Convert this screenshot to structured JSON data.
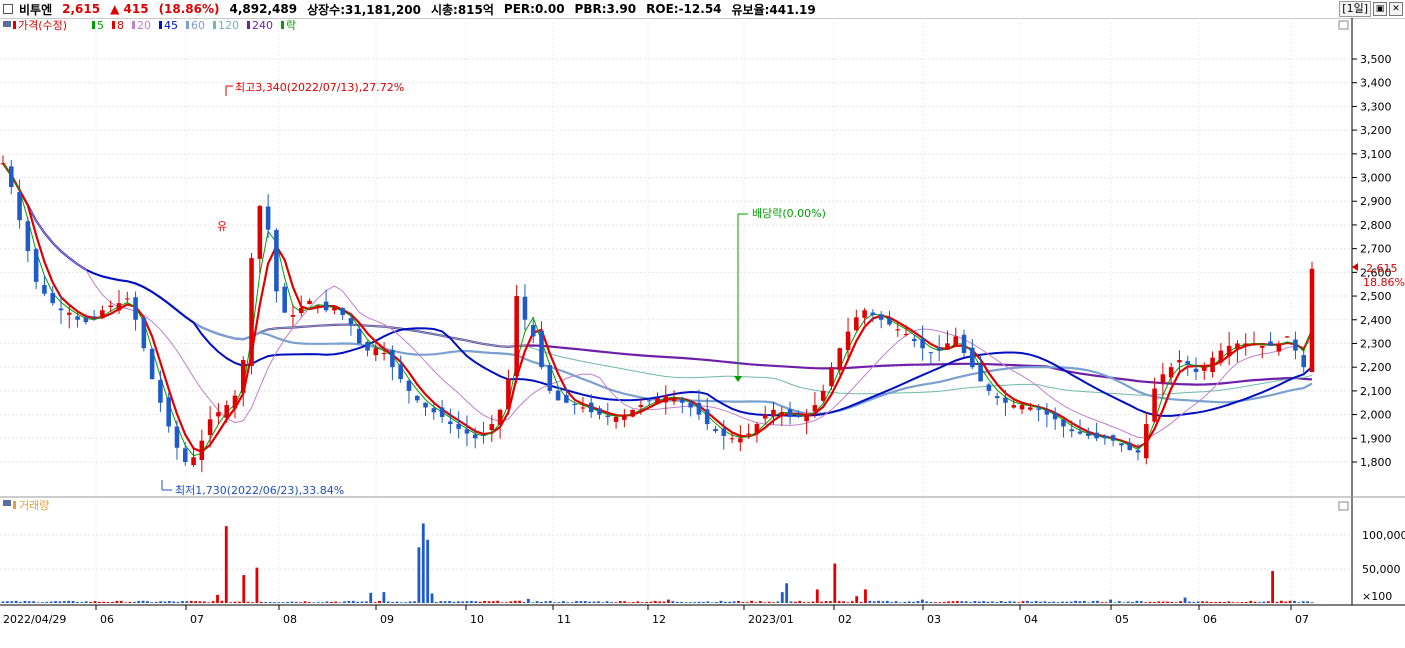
{
  "header": {
    "name": "비투엔",
    "price": "2,615",
    "change": "▲ 415",
    "change_pct": "(18.86%)",
    "volume": "4,892,489",
    "listed": "상장수:31,181,200",
    "mktcap": "시총:815억",
    "per": "PER:0.00",
    "pbr": "PBR:3.90",
    "roe": "ROE:-12.54",
    "reserve": "유보율:441.19",
    "period": "[1일]",
    "colors": {
      "up": "#e00000",
      "down": "#1e5ac8"
    }
  },
  "legend": [
    {
      "label": "가격(수정)",
      "color": "#e00000"
    },
    {
      "label": "5",
      "color": "#00a000"
    },
    {
      "label": "8",
      "color": "#e00000"
    },
    {
      "label": "20",
      "color": "#c080d0"
    },
    {
      "label": "45",
      "color": "#0010c0"
    },
    {
      "label": "60",
      "color": "#7aa0d0"
    },
    {
      "label": "120",
      "color": "#70b8a8"
    },
    {
      "label": "240",
      "color": "#7020a8"
    },
    {
      "label": "락",
      "color": "#00a000"
    }
  ],
  "annotations": {
    "high": "최고3,340(2022/07/13),27.72%",
    "low": "최저1,730(2022/06/23),33.84%",
    "dividend": "배당락(0.00%)",
    "rights_marker": "유",
    "last_price": "2,615",
    "last_pct": "18.86%"
  },
  "volume_label": "거래량",
  "chart_data": {
    "type": "candlestick",
    "y_ticks": [
      "3,500",
      "3,400",
      "3,300",
      "3,200",
      "3,100",
      "3,000",
      "2,900",
      "2,800",
      "2,700",
      "2,600",
      "2,500",
      "2,400",
      "2,300",
      "2,200",
      "2,100",
      "2,000",
      "1,900",
      "1,800"
    ],
    "volume_ticks": [
      "100,000",
      "50,000",
      "×100"
    ],
    "x_labels": [
      "2022/04/29",
      "06",
      "07",
      "08",
      "09",
      "10",
      "11",
      "12",
      "2023/01",
      "02",
      "03",
      "04",
      "05",
      "06",
      "07"
    ],
    "price_range": [
      1700,
      3600
    ],
    "volume_range": [
      0,
      125000
    ],
    "closes": [
      3060,
      2960,
      2820,
      2690,
      2560,
      2510,
      2470,
      2440,
      2430,
      2400,
      2390,
      2410,
      2440,
      2460,
      2470,
      2490,
      2400,
      2280,
      2150,
      2050,
      1950,
      1860,
      1800,
      1820,
      1890,
      1980,
      2010,
      2040,
      2080,
      2230,
      2660,
      2880,
      2780,
      2520,
      2430,
      2420,
      2450,
      2480,
      2460,
      2440,
      2450,
      2420,
      2380,
      2300,
      2270,
      2280,
      2260,
      2200,
      2150,
      2100,
      2060,
      2030,
      2010,
      1990,
      1960,
      1940,
      1920,
      1900,
      1910,
      1960,
      2020,
      2150,
      2500,
      2400,
      2330,
      2200,
      2100,
      2060,
      2050,
      2040,
      2030,
      2010,
      2000,
      1990,
      1990,
      2000,
      2020,
      2040,
      2060,
      2070,
      2080,
      2070,
      2050,
      2030,
      2000,
      1960,
      1930,
      1910,
      1900,
      1900,
      1920,
      1960,
      2000,
      2020,
      2010,
      1990,
      1990,
      2000,
      2040,
      2100,
      2200,
      2280,
      2350,
      2410,
      2440,
      2420,
      2400,
      2380,
      2360,
      2340,
      2310,
      2280,
      2260,
      2270,
      2300,
      2330,
      2260,
      2200,
      2140,
      2100,
      2070,
      2050,
      2040,
      2040,
      2030,
      2020,
      2000,
      1980,
      1950,
      1930,
      1920,
      1910,
      1900,
      1900,
      1890,
      1870,
      1850,
      1840,
      1960,
      2110,
      2170,
      2200,
      2230,
      2210,
      2180,
      2200,
      2240,
      2270,
      2290,
      2300,
      2300,
      2300,
      2290,
      2290,
      2300,
      2330,
      2270,
      2200,
      2615
    ],
    "volume_peaks": [
      [
        49,
        12000
      ],
      [
        51,
        113000
      ],
      [
        55,
        41000
      ],
      [
        58,
        52000
      ],
      [
        84,
        15000
      ],
      [
        87,
        16000
      ],
      [
        95,
        82000
      ],
      [
        96,
        117000
      ],
      [
        97,
        93000
      ],
      [
        98,
        14000
      ],
      [
        120,
        6000
      ],
      [
        152,
        5000
      ],
      [
        178,
        16000
      ],
      [
        179,
        29000
      ],
      [
        186,
        20000
      ],
      [
        190,
        58000
      ],
      [
        195,
        10000
      ],
      [
        197,
        20000
      ],
      [
        210,
        5000
      ],
      [
        253,
        5000
      ],
      [
        270,
        8000
      ],
      [
        290,
        47000
      ]
    ],
    "moving_averages": [
      "5",
      "8",
      "20",
      "45",
      "60",
      "120",
      "240"
    ]
  }
}
